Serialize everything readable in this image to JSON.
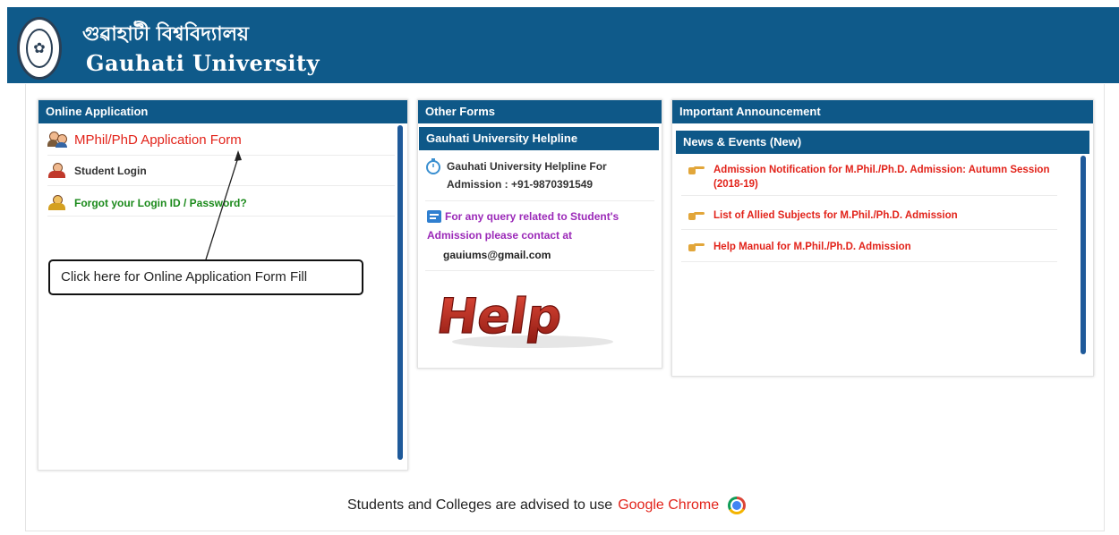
{
  "header": {
    "title_bn": "গুৱাহাটী বিশ্ববিদ্যালয়",
    "title_en": "Gauhati University"
  },
  "online_application": {
    "heading": "Online Application",
    "items": [
      {
        "label": "MPhil/PhD Application Form",
        "icon": "applicants-icon"
      },
      {
        "label": "Student Login",
        "icon": "student-icon"
      },
      {
        "label": "Forgot your Login ID / Password?",
        "icon": "user-key-icon"
      }
    ],
    "callout": "Click here for Online Application Form Fill"
  },
  "other_forms": {
    "heading": "Other Forms",
    "helpline_heading": "Gauhati University Helpline",
    "helpline_text": "Gauhati University Helpline For Admission : +91-9870391549",
    "query_text": "For any query related to Student's Admission please contact at",
    "email": "gauiums@gmail.com",
    "help_image_text": "Help"
  },
  "announcement": {
    "heading": "Important Announcement",
    "news_heading": "News & Events (New)",
    "items": [
      "Admission Notification for M.Phil./Ph.D. Admission: Autumn Session (2018-19)",
      "List of Allied Subjects for M.Phil./Ph.D. Admission",
      "Help Manual for M.Phil./Ph.D. Admission"
    ]
  },
  "footer": {
    "text": "Students and Colleges are advised to use",
    "browser": "Google Chrome"
  },
  "colors": {
    "header_blue": "#0f5a8a",
    "link_red": "#e2231a",
    "green": "#1b8a1b",
    "purple": "#9b29b8"
  }
}
